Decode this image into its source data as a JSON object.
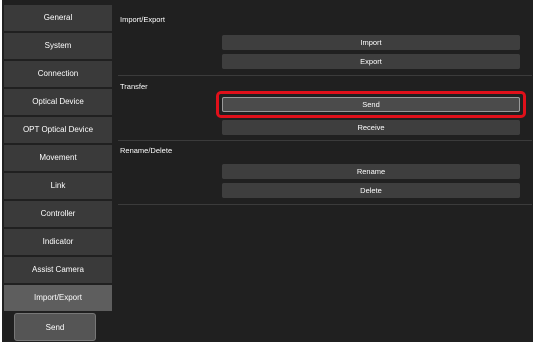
{
  "sidebar": {
    "items": [
      {
        "label": "General"
      },
      {
        "label": "System"
      },
      {
        "label": "Connection"
      },
      {
        "label": "Optical Device"
      },
      {
        "label": "OPT Optical Device"
      },
      {
        "label": "Movement"
      },
      {
        "label": "Link"
      },
      {
        "label": "Controller"
      },
      {
        "label": "Indicator"
      },
      {
        "label": "Assist Camera"
      },
      {
        "label": "Import/Export"
      }
    ],
    "selected": "Import/Export",
    "send_label": "Send"
  },
  "main": {
    "sections": [
      {
        "title": "Import/Export",
        "buttons": [
          "Import",
          "Export"
        ]
      },
      {
        "title": "Transfer",
        "buttons": [
          "Send",
          "Receive"
        ]
      },
      {
        "title": "Rename/Delete",
        "buttons": [
          "Rename",
          "Delete"
        ]
      }
    ],
    "highlighted_button": "Send"
  },
  "colors": {
    "background": "#202020",
    "button": "#3e3e3e",
    "highlight": "#e0101a"
  }
}
